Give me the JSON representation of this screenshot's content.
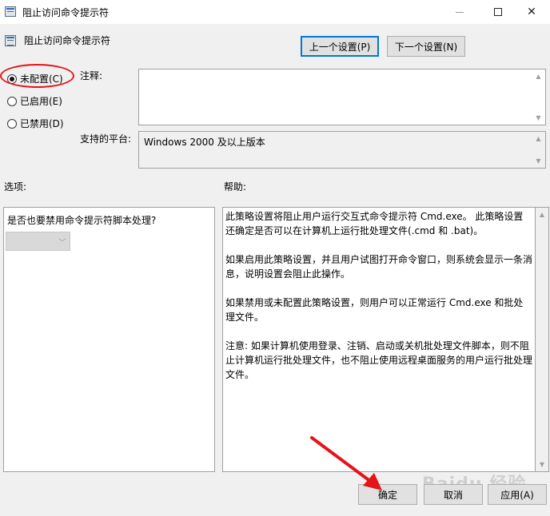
{
  "window": {
    "title": "阻止访问命令提示符",
    "minimize_glyph": "—",
    "maximize_glyph": "☐",
    "close_glyph": "✕"
  },
  "policy": {
    "title": "阻止访问命令提示符"
  },
  "nav": {
    "prev_label": "上一个设置(P)",
    "next_label": "下一个设置(N)"
  },
  "state": {
    "options": [
      {
        "label": "未配置(C)",
        "checked": true
      },
      {
        "label": "已启用(E)",
        "checked": false
      },
      {
        "label": "已禁用(D)",
        "checked": false
      }
    ]
  },
  "comment": {
    "label": "注释:",
    "value": ""
  },
  "platform": {
    "label": "支持的平台:",
    "value": "Windows 2000 及以上版本"
  },
  "options_section": {
    "label": "选项:",
    "question": "是否也要禁用命令提示符脚本处理?",
    "dropdown_value": ""
  },
  "help_section": {
    "label": "帮助:",
    "paragraphs": [
      "此策略设置将阻止用户运行交互式命令提示符 Cmd.exe。 此策略设置还确定是否可以在计算机上运行批处理文件(.cmd 和 .bat)。",
      "如果启用此策略设置，并且用户试图打开命令窗口，则系统会显示一条消息，说明设置会阻止此操作。",
      "如果禁用或未配置此策略设置，则用户可以正常运行 Cmd.exe 和批处理文件。",
      "注意: 如果计算机使用登录、注销、启动或关机批处理文件脚本，则不阻止计算机运行批处理文件，也不阻止使用远程桌面服务的用户运行批处理文件。"
    ]
  },
  "footer": {
    "ok_label": "确定",
    "cancel_label": "取消",
    "apply_label": "应用(A)"
  },
  "watermark": "Baidu 经验",
  "colors": {
    "accent": "#0078d7",
    "annotation_red": "#e5141b"
  },
  "icons": {
    "scroll_up": "▲",
    "scroll_down": "▼",
    "dropdown": "﹀"
  }
}
